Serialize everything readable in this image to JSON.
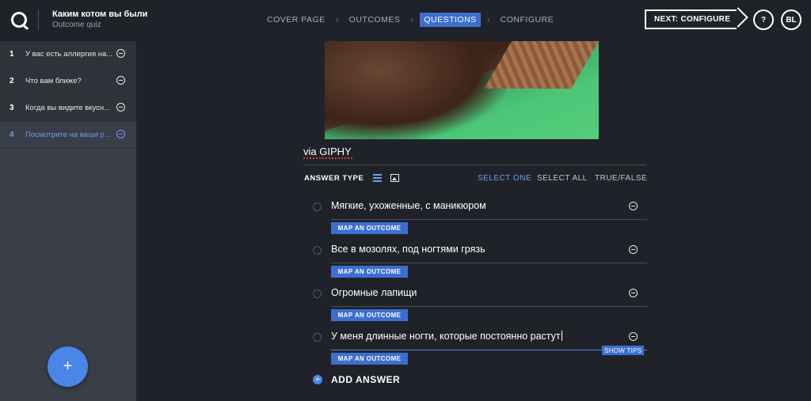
{
  "header": {
    "quiz_title": "Каким котом вы были в г",
    "quiz_subtitle": "Outcome quiz",
    "steps": [
      {
        "label": "COVER PAGE",
        "active": false
      },
      {
        "label": "OUTCOMES",
        "active": false
      },
      {
        "label": "QUESTIONS",
        "active": true
      },
      {
        "label": "CONFIGURE",
        "active": false
      }
    ],
    "next_label": "NEXT: CONFIGURE",
    "help_label": "?",
    "user_initials": "BL"
  },
  "sidebar": {
    "questions": [
      {
        "num": "1",
        "text": "У вас есть аллергия на...",
        "active": false
      },
      {
        "num": "2",
        "text": "Что вам ближе?",
        "active": false
      },
      {
        "num": "3",
        "text": "Когда вы видите вкусн...",
        "active": false
      },
      {
        "num": "4",
        "text": "Посмотрите на ваши р...",
        "active": true
      }
    ],
    "add_label": "+"
  },
  "main": {
    "caption": "via GIPHY",
    "answer_type_label": "ANSWER TYPE",
    "type_options": [
      "SELECT ONE",
      "SELECT ALL",
      "TRUE/FALSE"
    ],
    "selected_type": "SELECT ONE",
    "answers": [
      {
        "text": "Мягкие, ухоженные, с маникюром",
        "map_label": "MAP AN OUTCOME"
      },
      {
        "text": "Все в мозолях, под ногтями грязь",
        "map_label": "MAP AN OUTCOME"
      },
      {
        "text": "Огромные лапищи",
        "map_label": "MAP AN OUTCOME"
      },
      {
        "text": "У меня длинные ногти, которые постоянно растут",
        "map_label": "MAP AN OUTCOME"
      }
    ],
    "show_tips_label": "SHOW TIPS",
    "add_answer_label": "ADD ANSWER"
  },
  "colors": {
    "accent": "#4a86e8",
    "active_step": "#3d6fd1",
    "background": "#1f2329",
    "sidebar": "#3a3f47"
  }
}
